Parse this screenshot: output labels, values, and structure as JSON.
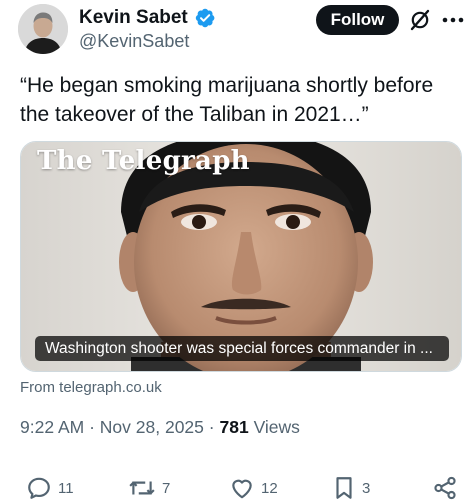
{
  "author": {
    "display_name": "Kevin Sabet",
    "handle": "@KevinSabet",
    "verified": true
  },
  "header": {
    "follow_label": "Follow",
    "icons": [
      "grok-icon",
      "more-icon"
    ]
  },
  "tweet": {
    "text": "“He began smoking marijuana shortly before the takeover of the Taliban in 2021…”"
  },
  "media": {
    "publisher_logo": "The Telegraph",
    "caption": "Washington shooter was special forces commander in ...",
    "source": "From telegraph.co.uk"
  },
  "meta": {
    "time": "9:22 AM",
    "separator": "·",
    "date": "Nov 28, 2025",
    "views_count": "781",
    "views_label": "Views"
  },
  "actions": {
    "reply_count": "11",
    "retweet_count": "7",
    "like_count": "12",
    "bookmark_count": "3"
  },
  "colors": {
    "text_primary": "#0f1419",
    "text_secondary": "#536471",
    "verified_blue": "#1d9bf0",
    "follow_bg": "#0f1419"
  }
}
